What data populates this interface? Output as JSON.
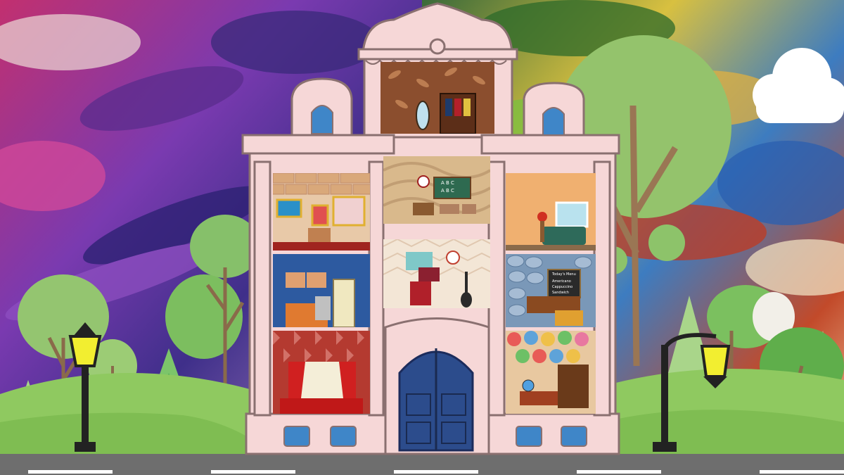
{
  "scene": {
    "rooms": [
      {
        "id": "wardrobe",
        "floor": "attic"
      },
      {
        "id": "art-gallery",
        "floor": 3
      },
      {
        "id": "classroom",
        "floor": 3
      },
      {
        "id": "living-room",
        "floor": 3
      },
      {
        "id": "kitchen",
        "floor": 2
      },
      {
        "id": "computer-room",
        "floor": 2
      },
      {
        "id": "cafe",
        "floor": 2
      },
      {
        "id": "theater",
        "floor": 1
      },
      {
        "id": "library",
        "floor": 1
      }
    ],
    "blackboard": {
      "line1": "A B C",
      "line2": "A B C"
    },
    "cafe_board": {
      "line1": "Today's Menu",
      "line2": "Americano",
      "line3": "Cappuccino",
      "line4": "Sandwich"
    }
  },
  "colors": {
    "house_pink": "#f6d7d7",
    "house_outline": "#8a7070",
    "window_blue": "#3f86c8",
    "door_blue": "#2c4c8c",
    "road": "#6e6e6e",
    "grass_light": "#8fc960",
    "tree_green": "#8ec36d"
  },
  "icons": [
    "street-lamp-icon",
    "tree-icon",
    "cloud-icon",
    "clock-icon",
    "mirror-icon",
    "guitar-icon",
    "globe-icon"
  ]
}
